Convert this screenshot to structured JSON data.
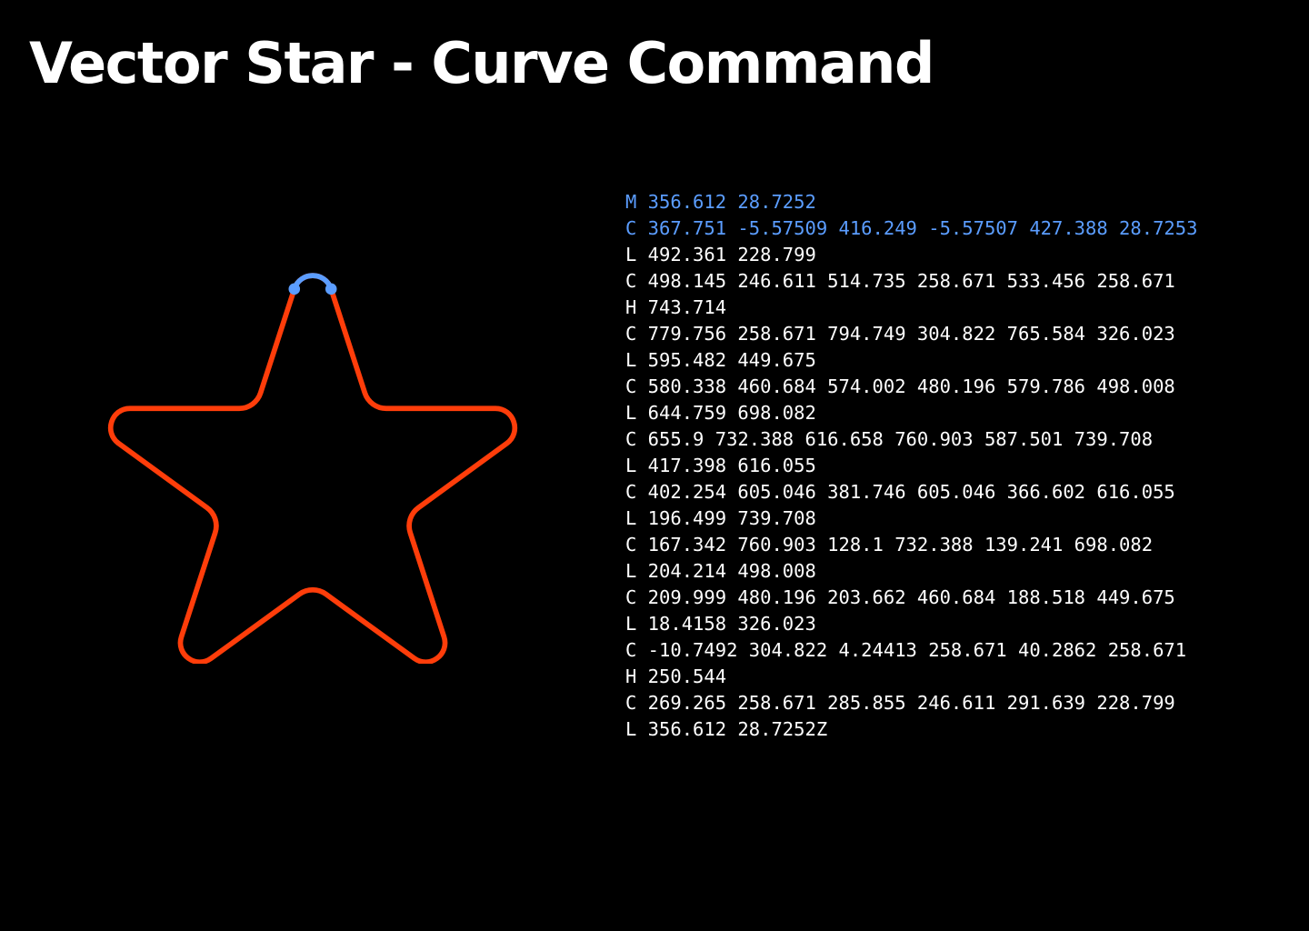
{
  "title": "Vector Star - Curve Command",
  "colors": {
    "background": "#000000",
    "star_stroke": "#ff3d0a",
    "highlight": "#5b9dff",
    "text": "#ffffff"
  },
  "path_commands": [
    {
      "text": "M 356.612 28.7252",
      "highlighted": true
    },
    {
      "text": "C 367.751 -5.57509 416.249 -5.57507 427.388 28.7253",
      "highlighted": true
    },
    {
      "text": "L 492.361 228.799",
      "highlighted": false
    },
    {
      "text": "C 498.145 246.611 514.735 258.671 533.456 258.671",
      "highlighted": false
    },
    {
      "text": "H 743.714",
      "highlighted": false
    },
    {
      "text": "C 779.756 258.671 794.749 304.822 765.584 326.023",
      "highlighted": false
    },
    {
      "text": "L 595.482 449.675",
      "highlighted": false
    },
    {
      "text": "C 580.338 460.684 574.002 480.196 579.786 498.008",
      "highlighted": false
    },
    {
      "text": "L 644.759 698.082",
      "highlighted": false
    },
    {
      "text": "C 655.9 732.388 616.658 760.903 587.501 739.708",
      "highlighted": false
    },
    {
      "text": "L 417.398 616.055",
      "highlighted": false
    },
    {
      "text": "C 402.254 605.046 381.746 605.046 366.602 616.055",
      "highlighted": false
    },
    {
      "text": "L 196.499 739.708",
      "highlighted": false
    },
    {
      "text": "C 167.342 760.903 128.1 732.388 139.241 698.082",
      "highlighted": false
    },
    {
      "text": "L 204.214 498.008",
      "highlighted": false
    },
    {
      "text": "C 209.999 480.196 203.662 460.684 188.518 449.675",
      "highlighted": false
    },
    {
      "text": "L 18.4158 326.023",
      "highlighted": false
    },
    {
      "text": "C -10.7492 304.822 4.24413 258.671 40.2862 258.671",
      "highlighted": false
    },
    {
      "text": "H 250.544",
      "highlighted": false
    },
    {
      "text": "C 269.265 258.671 285.855 246.611 291.639 228.799",
      "highlighted": false
    },
    {
      "text": "L 356.612 28.7252Z",
      "highlighted": false
    }
  ]
}
